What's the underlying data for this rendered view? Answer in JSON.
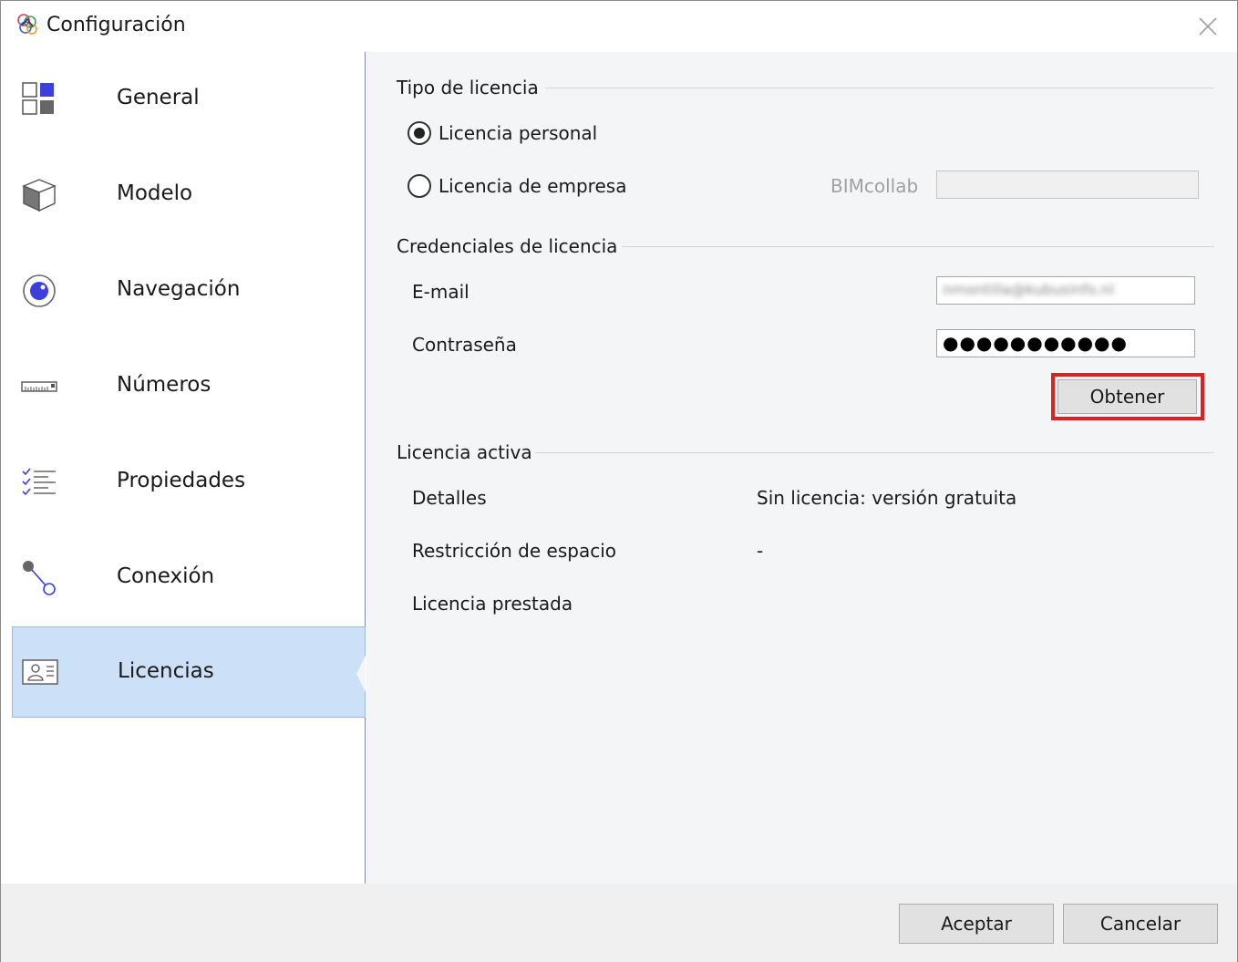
{
  "window": {
    "title": "Configuración"
  },
  "sidebar": {
    "items": [
      {
        "label": "General",
        "icon": "general-grid-icon"
      },
      {
        "label": "Modelo",
        "icon": "cube-icon"
      },
      {
        "label": "Navegación",
        "icon": "navigation-eye-icon"
      },
      {
        "label": "Números",
        "icon": "ruler-icon"
      },
      {
        "label": "Propiedades",
        "icon": "checklist-icon"
      },
      {
        "label": "Conexión",
        "icon": "connection-icon"
      },
      {
        "label": "Licencias",
        "icon": "id-card-icon"
      }
    ],
    "selected": "Licencias"
  },
  "license_type": {
    "title": "Tipo de licencia",
    "personal_label": "Licencia personal",
    "company_label": "Licencia de empresa",
    "selected": "personal",
    "bimcollab_label": "BIMcollab",
    "bimcollab_value": ""
  },
  "credentials": {
    "title": "Credenciales de licencia",
    "email_label": "E-mail",
    "email_value": "nmontilla@kubusinfo.nl",
    "password_label": "Contraseña",
    "password_value": "●●●●●●●●●●●",
    "obtain_button": "Obtener"
  },
  "active_license": {
    "title": "Licencia activa",
    "details_label": "Detalles",
    "details_value": "Sin licencia: versión gratuita",
    "space_label": "Restricción de espacio",
    "space_value": "-",
    "borrowed_label": "Licencia prestada"
  },
  "footer": {
    "accept_button": "Aceptar",
    "cancel_button": "Cancelar"
  },
  "colors": {
    "accent_blue": "#3b3fe0",
    "selected_bg": "#cce0f7",
    "highlight_red": "#e02020"
  }
}
